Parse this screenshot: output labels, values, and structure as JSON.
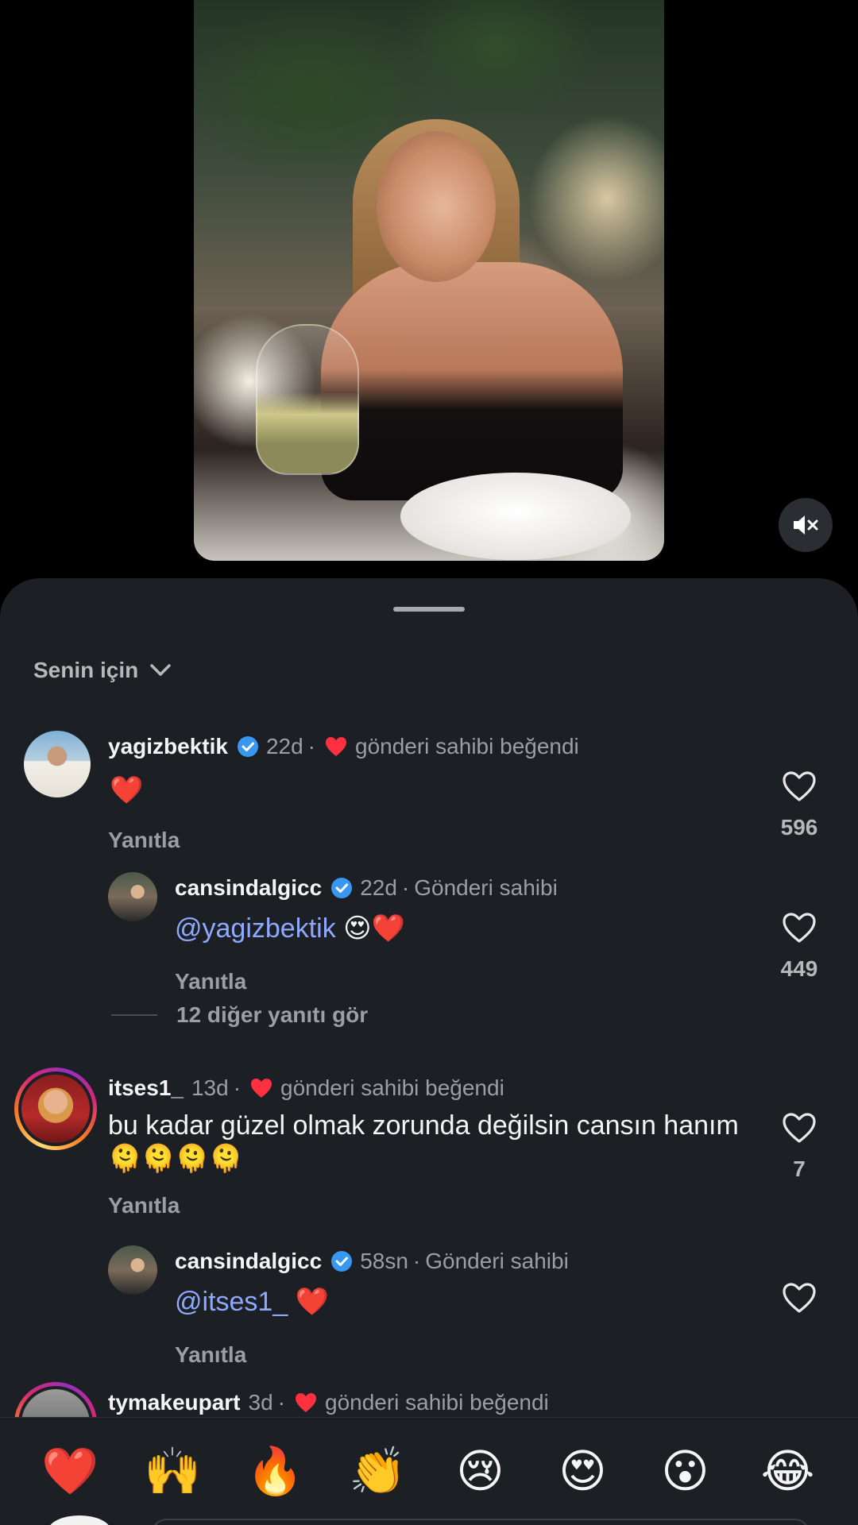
{
  "sheet": {
    "sort_label": "Senin için"
  },
  "comments": [
    {
      "username": "yagizbektik",
      "time": "22d",
      "liked_by_author": "gönderi sahibi beğendi",
      "text": "❤️",
      "reply_label": "Yanıtla",
      "like_count": "596"
    },
    {
      "username": "cansindalgicc",
      "time": "22d",
      "author_tag": "Gönderi sahibi",
      "mention": "@yagizbektik",
      "text": "😍❤️",
      "reply_label": "Yanıtla",
      "like_count": "449"
    },
    {
      "username": "itses1_",
      "time": "13d",
      "liked_by_author": "gönderi sahibi beğendi",
      "text": "bu kadar güzel olmak zorunda değilsin cansın hanım 🫠🫠🫠🫠",
      "reply_label": "Yanıtla",
      "like_count": "7"
    },
    {
      "username": "cansindalgicc",
      "time": "58sn",
      "author_tag": "Gönderi sahibi",
      "mention": "@itses1_",
      "text": "❤️",
      "reply_label": "Yanıtla"
    },
    {
      "username": "tymakeupart",
      "time": "3d",
      "liked_by_author": "gönderi sahibi beğendi"
    }
  ],
  "more_replies": "12 diğer yanıtı gör",
  "emoji_bar": [
    "❤️",
    "🙌",
    "🔥",
    "👏",
    "😢",
    "😍",
    "😮",
    "😂"
  ],
  "colors": {
    "sheet_bg": "#1c1f23",
    "mention": "#8ea9ff",
    "verified": "#3897f0",
    "heart_red": "#ff3040"
  }
}
